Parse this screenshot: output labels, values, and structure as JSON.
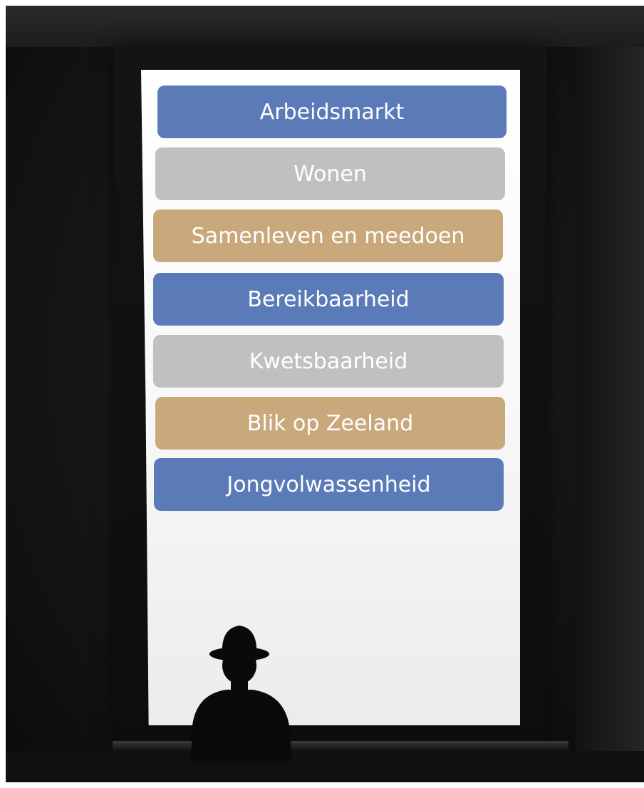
{
  "topics": [
    {
      "label": "Arbeidsmarkt",
      "color": "#5b7bb8"
    },
    {
      "label": "Wonen",
      "color": "#c0c0c0"
    },
    {
      "label": "Samenleven en meedoen",
      "color": "#c9a87c"
    },
    {
      "label": "Bereikbaarheid",
      "color": "#5b7bb8"
    },
    {
      "label": "Kwetsbaarheid",
      "color": "#c0c0c0"
    },
    {
      "label": "Blik op Zeeland",
      "color": "#c9a87c"
    },
    {
      "label": "Jongvolwassenheid",
      "color": "#5b7bb8"
    }
  ],
  "background": {
    "scene": "silhouette of a man in a bowler hat looking out a tall bright window"
  }
}
